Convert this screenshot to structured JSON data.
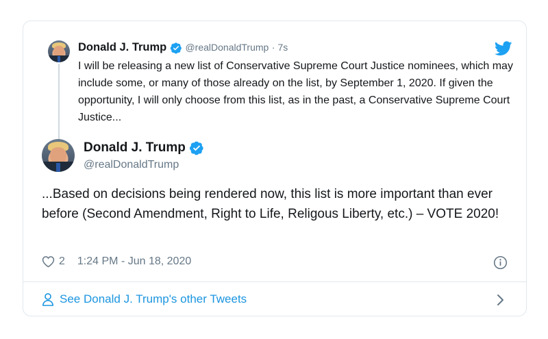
{
  "quoted_tweet": {
    "name": "Donald J. Trump",
    "handle": "@realDonaldTrump",
    "time_ago": "· 7s",
    "text": "I will be releasing a new list of Conservative Supreme Court Justice nominees, which may include some, or many of those already on the list, by September 1, 2020. If given the opportunity, I will only choose from this list, as in the past, a Conservative Supreme Court Justice..."
  },
  "main_tweet": {
    "name": "Donald J. Trump",
    "handle": "@realDonaldTrump",
    "text": "...Based on decisions being rendered now, this list is more important than ever before (Second Amendment, Right to Life, Religous Liberty, etc.) – VOTE 2020!",
    "like_count": "2",
    "timestamp": "1:24 PM - Jun 18, 2020"
  },
  "footer": {
    "link_label": "See Donald J. Trump's other Tweets"
  },
  "icons": {
    "brand": "twitter-bird-icon",
    "verified": "verified-badge-icon",
    "like": "heart-icon",
    "info": "info-icon",
    "profile": "person-icon",
    "chevron": "chevron-right-icon"
  },
  "colors": {
    "twitter_blue": "#1da1f2",
    "link_blue": "#1b95e0",
    "muted_gray": "#657786",
    "text_dark": "#14171a",
    "border": "#e1e8ed"
  }
}
